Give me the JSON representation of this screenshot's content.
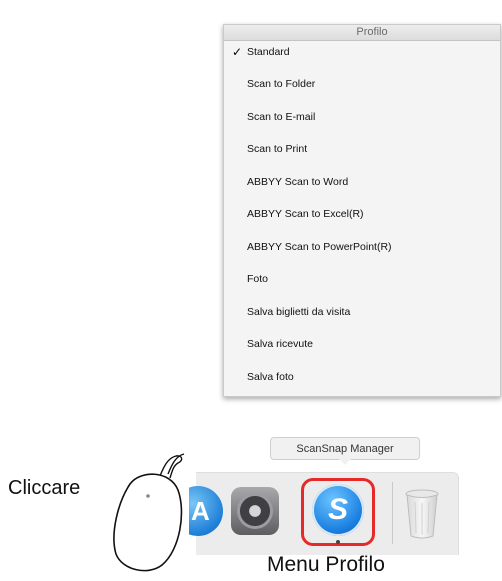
{
  "profile_menu": {
    "title": "Profilo",
    "check_mark": "✓",
    "items": [
      {
        "label": "Standard",
        "checked": true
      },
      {
        "label": "Scan to Folder",
        "checked": false
      },
      {
        "label": "Scan to E-mail",
        "checked": false
      },
      {
        "label": "Scan to Print",
        "checked": false
      },
      {
        "label": "ABBYY Scan to Word",
        "checked": false
      },
      {
        "label": "ABBYY Scan to Excel(R)",
        "checked": false
      },
      {
        "label": "ABBYY Scan to PowerPoint(R)",
        "checked": false
      },
      {
        "label": "Foto",
        "checked": false
      },
      {
        "label": "Salva biglietti da visita",
        "checked": false
      },
      {
        "label": "Salva ricevute",
        "checked": false
      },
      {
        "label": "Salva foto",
        "checked": false
      }
    ]
  },
  "dock": {
    "tooltip": "ScanSnap Manager",
    "icons": [
      "app-store-icon",
      "system-preferences-icon",
      "scansnap-manager-icon",
      "trash-icon"
    ],
    "highlight_color": "#e62a2a"
  },
  "annotations": {
    "click_label": "Cliccare",
    "menu_label": "Menu Profilo"
  }
}
